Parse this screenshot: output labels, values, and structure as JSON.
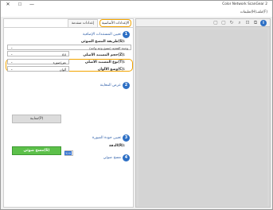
{
  "window": {
    "title": "Color Network ScanGear 2",
    "close_glyph": "✕",
    "maximize_glyph": "☐",
    "minimize_glyph": "—"
  },
  "menu": {
    "file": "ملف(F)",
    "settings": "تعليمات(H)"
  },
  "tabs": {
    "basic": "الإعدادات الأساسية",
    "advanced": "إعدادات متقدمة"
  },
  "sections": {
    "s1_number": "1",
    "s1_label": "تعيين المستندات الإضافية",
    "s2_number": "2",
    "s2_label": "عرض المعاينة",
    "s3_number": "3",
    "s3_label": "تعيين جودة الصورة",
    "s4_number": "4",
    "s4_label": "مسح ضوئي"
  },
  "fields": {
    "scan_method_label": "طريقة المسح الضوئي(S):",
    "scan_method_value": "وحدة التغذية (مسح وجه واحد)",
    "doc_size_label": "حجم المستند الأصلي(Z):",
    "doc_size_value": "A4",
    "doc_type_label": "نوع المستند الأصلي(T):",
    "doc_type_value": "نص/صورة",
    "color_mode_label": "وضع الألوان(C):",
    "color_mode_value": "ألوان",
    "resolution_label": "الدقة(R):",
    "resolution_value": "300",
    "resolution_unit": "dpi"
  },
  "buttons": {
    "preview": "معاينة(P)",
    "scan": "مسح ضوئي(S)"
  },
  "toolbar_icons": [
    "info-icon",
    "copy-icon",
    "crop-icon",
    "zoom-icon",
    "rotate-icon",
    "select-all-icon",
    "delete-icon"
  ],
  "colors": {
    "accent_blue": "#2d6fc4",
    "highlight_orange": "#f2a400",
    "scan_green": "#5cc04a"
  }
}
